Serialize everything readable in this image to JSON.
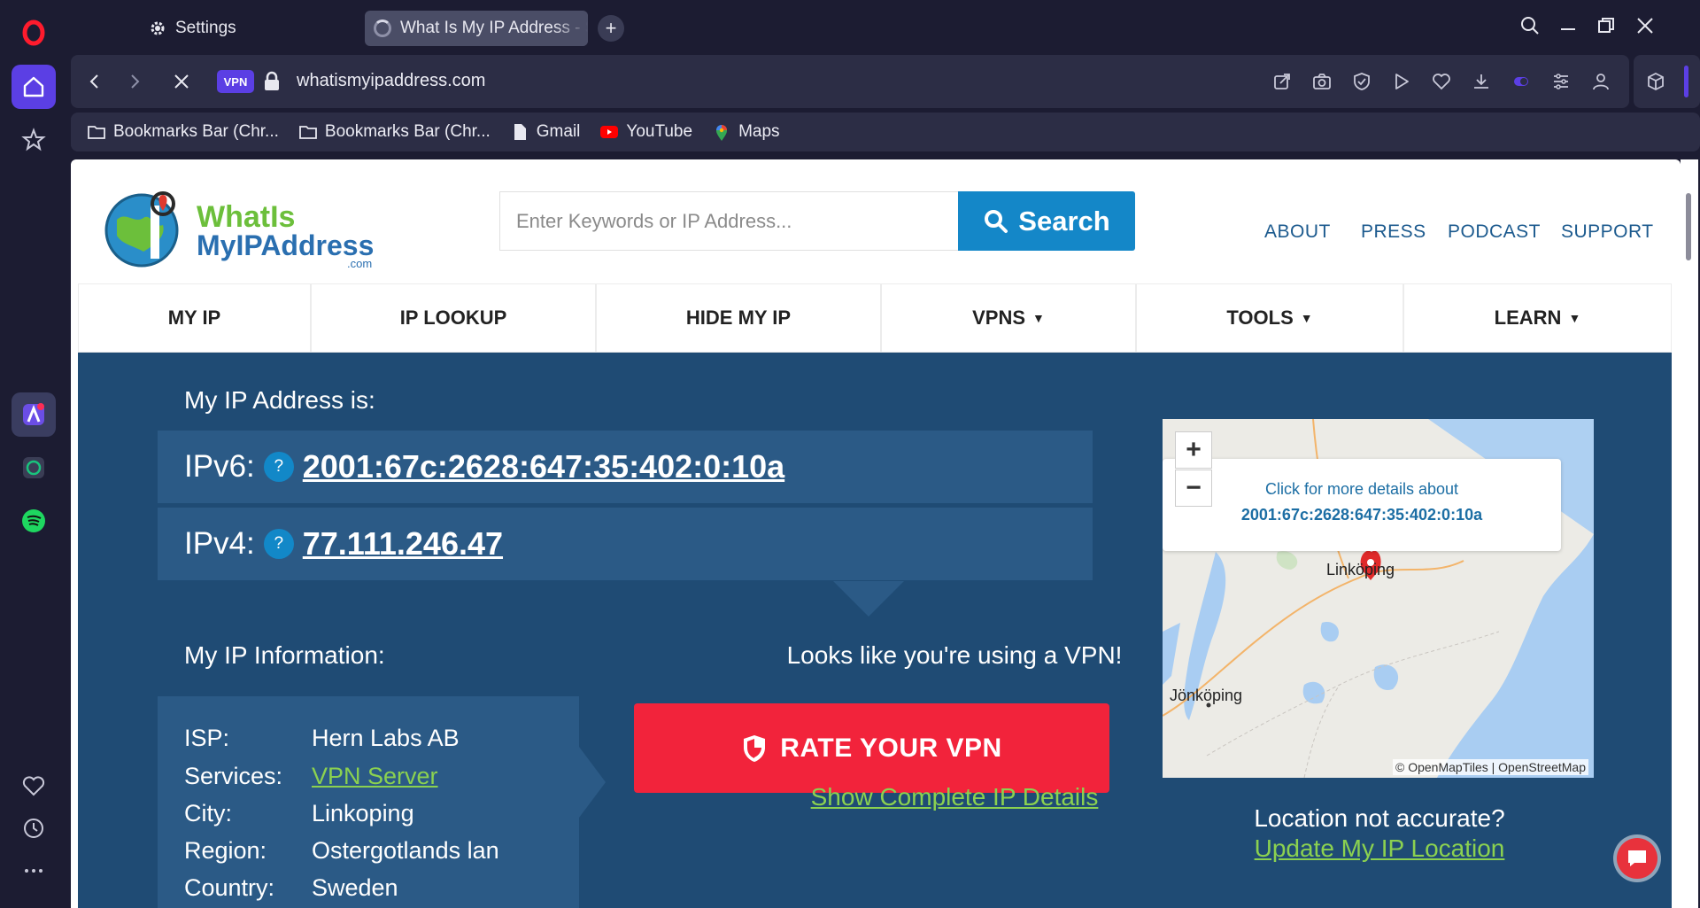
{
  "browser": {
    "tabs": [
      {
        "label": "Settings"
      },
      {
        "label": "What Is My IP Address - S"
      }
    ],
    "vpn_badge": "VPN",
    "url": "whatismyipaddress.com",
    "bookmarks": [
      {
        "label": "Bookmarks Bar (Chr..."
      },
      {
        "label": "Bookmarks Bar (Chr..."
      },
      {
        "label": "Gmail"
      },
      {
        "label": "YouTube"
      },
      {
        "label": "Maps"
      }
    ]
  },
  "site": {
    "logo": {
      "line1": "WhatIs",
      "line2": "MyIPAddress",
      "line3": ".com"
    },
    "search_placeholder": "Enter Keywords or IP Address...",
    "search_button": "Search",
    "toplinks": [
      "ABOUT",
      "PRESS",
      "PODCAST",
      "SUPPORT"
    ],
    "nav": [
      "MY IP",
      "IP LOOKUP",
      "HIDE MY IP",
      "VPNS",
      "TOOLS",
      "LEARN"
    ],
    "nav_caret": "▼"
  },
  "hero": {
    "ip_label": "My IP Address is:",
    "ipv6_label": "IPv6:",
    "ipv6_value": "2001:67c:2628:647:35:402:0:10a",
    "ipv4_label": "IPv4:",
    "ipv4_value": "77.111.246.47",
    "help": "?",
    "info_label": "My IP Information:",
    "info": [
      {
        "key": "ISP:",
        "value": "Hern Labs AB"
      },
      {
        "key": "Services:",
        "value": "VPN Server"
      },
      {
        "key": "City:",
        "value": "Linkoping"
      },
      {
        "key": "Region:",
        "value": "Ostergotlands lan"
      },
      {
        "key": "Country:",
        "value": "Sweden"
      }
    ],
    "vpn_message": "Looks like you're using a VPN!",
    "rate_button": "RATE YOUR VPN",
    "complete_details": "Show Complete IP Details",
    "location_question": "Location not accurate?",
    "update_location": "Update My IP Location"
  },
  "map": {
    "zoom_in": "+",
    "zoom_out": "−",
    "popup_line1": "Click for more details about",
    "popup_line2": "2001:67c:2628:647:35:402:0:10a",
    "city1": "Linköping",
    "city2": "Jönköping",
    "attribution": "© OpenMapTiles | OpenStreetMap"
  },
  "colors": {
    "hero_bg": "#1f4b74",
    "row_bg": "#2b5a86",
    "accent_blue": "#1487c8",
    "rate_red": "#f2233b",
    "link_green": "#8bd150"
  }
}
